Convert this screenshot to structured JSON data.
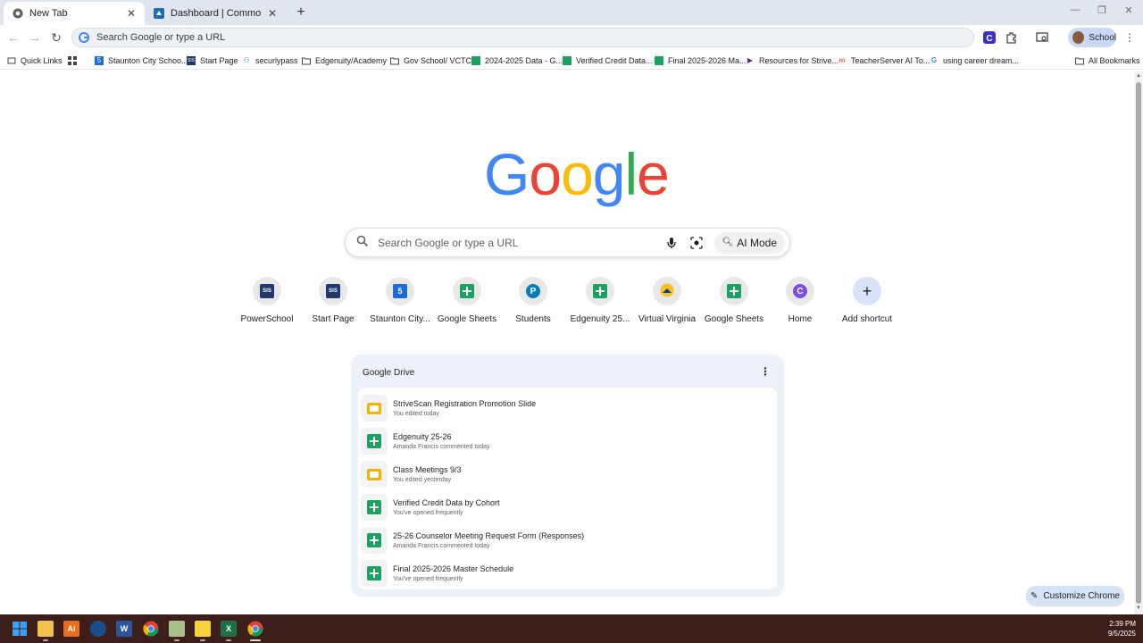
{
  "tabs": [
    {
      "title": "New Tab",
      "active": true
    },
    {
      "title": "Dashboard | Common App",
      "active": false
    }
  ],
  "omnibox": {
    "placeholder": "Search Google or type a URL"
  },
  "profile": {
    "label": "School"
  },
  "bookmarks": [
    {
      "label": "Quick Links"
    },
    {
      "label": "Staunton City Schoo..."
    },
    {
      "label": "Start Page"
    },
    {
      "label": "securlypass"
    },
    {
      "label": "Edgenuity/Academy"
    },
    {
      "label": "Gov School/ VCTC"
    },
    {
      "label": "2024-2025 Data - G..."
    },
    {
      "label": "Verified Credit Data..."
    },
    {
      "label": "Final 2025-2026 Ma..."
    },
    {
      "label": "Resources for Strive..."
    },
    {
      "label": "TeacherServer AI To..."
    },
    {
      "label": "using career dream..."
    },
    {
      "label": "All Bookmarks"
    }
  ],
  "logo": {
    "letters": [
      "G",
      "o",
      "o",
      "g",
      "l",
      "e"
    ],
    "colors": [
      "#4285f4",
      "#ea4335",
      "#fbbc05",
      "#4285f4",
      "#34a853",
      "#ea4335"
    ]
  },
  "search": {
    "placeholder": "Search Google or type a URL",
    "ai_mode_label": "AI Mode"
  },
  "shortcuts": [
    {
      "label": "PowerSchool",
      "icon": "sis-icon",
      "icon_text": "SIS"
    },
    {
      "label": "Start Page",
      "icon": "sis-icon",
      "icon_text": "SIS"
    },
    {
      "label": "Staunton City...",
      "icon": "staunton-icon",
      "icon_text": "5"
    },
    {
      "label": "Google Sheets",
      "icon": "sheets-icon"
    },
    {
      "label": "Students",
      "icon": "pearson-icon",
      "icon_text": "P"
    },
    {
      "label": "Edgenuity 25...",
      "icon": "sheets-icon"
    },
    {
      "label": "Virtual Virginia",
      "icon": "virtual-virginia-icon"
    },
    {
      "label": "Google Sheets",
      "icon": "sheets-icon"
    },
    {
      "label": "Home",
      "icon": "canva-icon",
      "icon_text": "C"
    },
    {
      "label": "Add shortcut",
      "icon": "plus-icon",
      "icon_text": "+"
    }
  ],
  "drive": {
    "title": "Google Drive",
    "items": [
      {
        "name": "StriveScan Registration Promotion Slide",
        "sub": "You edited today",
        "type": "slides"
      },
      {
        "name": "Edgenuity 25-26",
        "sub": "Amanda Francis commented today",
        "type": "sheets"
      },
      {
        "name": "Class Meetings 9/3",
        "sub": "You edited yesterday",
        "type": "slides"
      },
      {
        "name": "Verified Credit Data by Cohort",
        "sub": "You've opened frequently",
        "type": "sheets"
      },
      {
        "name": "25-26 Counselor Meeting Request Form (Responses)",
        "sub": "Amanda Francis commented today",
        "type": "sheets"
      },
      {
        "name": "Final 2025-2026 Master Schedule",
        "sub": "You've opened frequently",
        "type": "sheets"
      }
    ]
  },
  "customize": {
    "label": "Customize Chrome"
  },
  "taskbar": {
    "time": "2:39 PM",
    "date": "9/5/2025"
  }
}
